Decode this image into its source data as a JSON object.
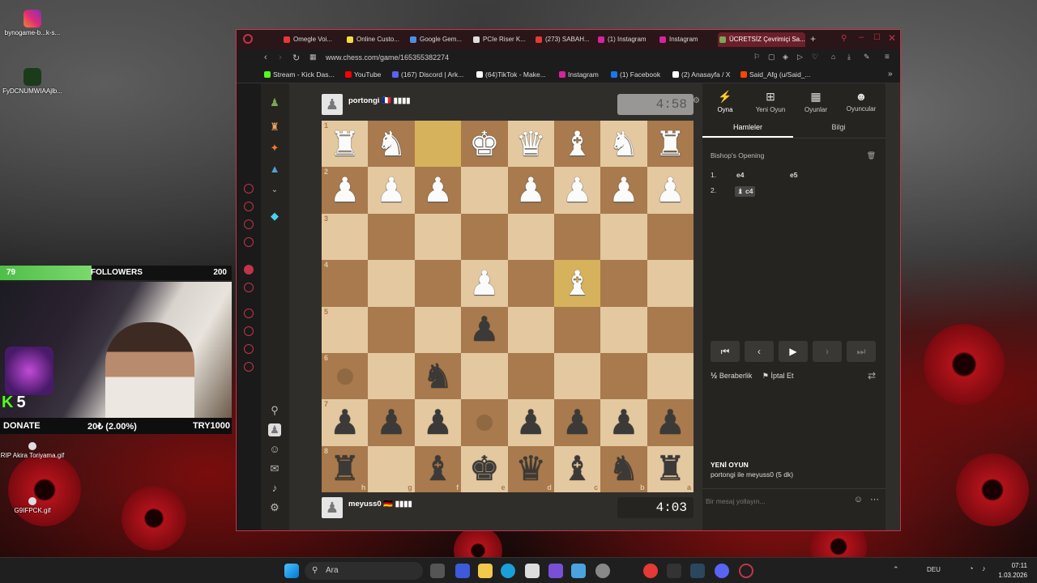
{
  "desktop": {
    "icons": [
      {
        "label": "bynogame-b...k-s..."
      },
      {
        "label": "FyDCNUMWIAAjlb..."
      },
      {
        "label": "RIP Akira Toriyama.gif"
      },
      {
        "label": "G9IFPCK.gif"
      }
    ]
  },
  "overlay": {
    "followers_current": "79",
    "followers_label": "FOLLOWERS",
    "followers_goal": "200",
    "followers_progress": 0.395,
    "kick_count": "5",
    "donate_label": "DONATE",
    "donate_progress": "20₺ (2.00%)",
    "donate_goal": "TRY1000"
  },
  "browser": {
    "tabs": [
      {
        "label": "Omegle Voi...",
        "color": "#e53935"
      },
      {
        "label": "Online Custo...",
        "color": "#f0e040"
      },
      {
        "label": "Google Gem...",
        "color": "#4a90e2"
      },
      {
        "label": "PCIe Riser K...",
        "color": "#dddddd"
      },
      {
        "label": "(273) SABAH...",
        "color": "#e53935"
      },
      {
        "label": "(1) Instagram",
        "color": "#d6249f"
      },
      {
        "label": "Instagram",
        "color": "#d6249f"
      },
      {
        "label": "ÜCRETSİZ Çevrimiçi Sa...",
        "color": "#7fa650"
      }
    ],
    "url": "www.chess.com/game/165355382274",
    "bookmarks": [
      {
        "label": "Stream - Kick Das...",
        "color": "#53fc18"
      },
      {
        "label": "YouTube",
        "color": "#ff0000"
      },
      {
        "label": "(167) Discord | Ark...",
        "color": "#5865f2"
      },
      {
        "label": "(64)TikTok - Make...",
        "color": "#ffffff"
      },
      {
        "label": "Instagram",
        "color": "#d6249f"
      },
      {
        "label": "(1) Facebook",
        "color": "#1877f2"
      },
      {
        "label": "(2) Anasayfa / X",
        "color": "#ffffff"
      },
      {
        "label": "Said_Afg (u/Said_...",
        "color": "#ff4500"
      }
    ]
  },
  "game": {
    "top_player": {
      "name": "portongi 🇫🇷 ▮▮▮▮",
      "clock": "4:58"
    },
    "bottom_player": {
      "name": "meyuss0 🇩🇪 ▮▮▮▮",
      "clock": "4:03"
    },
    "board": [
      [
        "wR",
        "wN",
        "",
        "wK",
        "wQ",
        "wB",
        "wN",
        "wR"
      ],
      [
        "wP",
        "wP",
        "wP",
        "",
        "wP",
        "wP",
        "wP",
        "wP"
      ],
      [
        "",
        "",
        "",
        "",
        "",
        "",
        "",
        ""
      ],
      [
        "",
        "",
        "",
        "wP",
        "",
        "wB",
        "",
        ""
      ],
      [
        "",
        "",
        "",
        "bP",
        "",
        "",
        "",
        ""
      ],
      [
        "",
        "",
        "bN",
        "",
        "",
        "",
        "",
        ""
      ],
      [
        "bP",
        "bP",
        "bP",
        "",
        "bP",
        "bP",
        "bP",
        "bP"
      ],
      [
        "bR",
        "",
        "bB",
        "bK",
        "bQ",
        "bB",
        "bN",
        "bR"
      ]
    ],
    "ranks": [
      "1",
      "2",
      "3",
      "4",
      "5",
      "6",
      "7",
      "8"
    ],
    "files": [
      "h",
      "g",
      "f",
      "e",
      "d",
      "c",
      "b",
      "a"
    ]
  },
  "panel": {
    "tabs": [
      {
        "label": "Oyna",
        "icon": "lightning-icon"
      },
      {
        "label": "Yeni Oyun",
        "icon": "plus-icon"
      },
      {
        "label": "Oyunlar",
        "icon": "board-icon"
      },
      {
        "label": "Oyuncular",
        "icon": "players-icon"
      }
    ],
    "subtabs": [
      "Hamleler",
      "Bilgi"
    ],
    "opening": "Bishop's Opening",
    "moves": [
      {
        "num": "1.",
        "white": "e4",
        "black": "e5"
      },
      {
        "num": "2.",
        "white": "♝ c4",
        "black": ""
      }
    ],
    "draw_label": "Beraberlik",
    "abort_label": "İptal Et",
    "new_game_title": "YENİ OYUN",
    "new_game_desc": "portongi ile meyuss0 (5 dk)",
    "chat_placeholder": "Bir mesaj yollayın..."
  },
  "taskbar": {
    "search_label": "Ara",
    "lang": "DEU",
    "time": "07:11",
    "date": "1.03.2026"
  }
}
